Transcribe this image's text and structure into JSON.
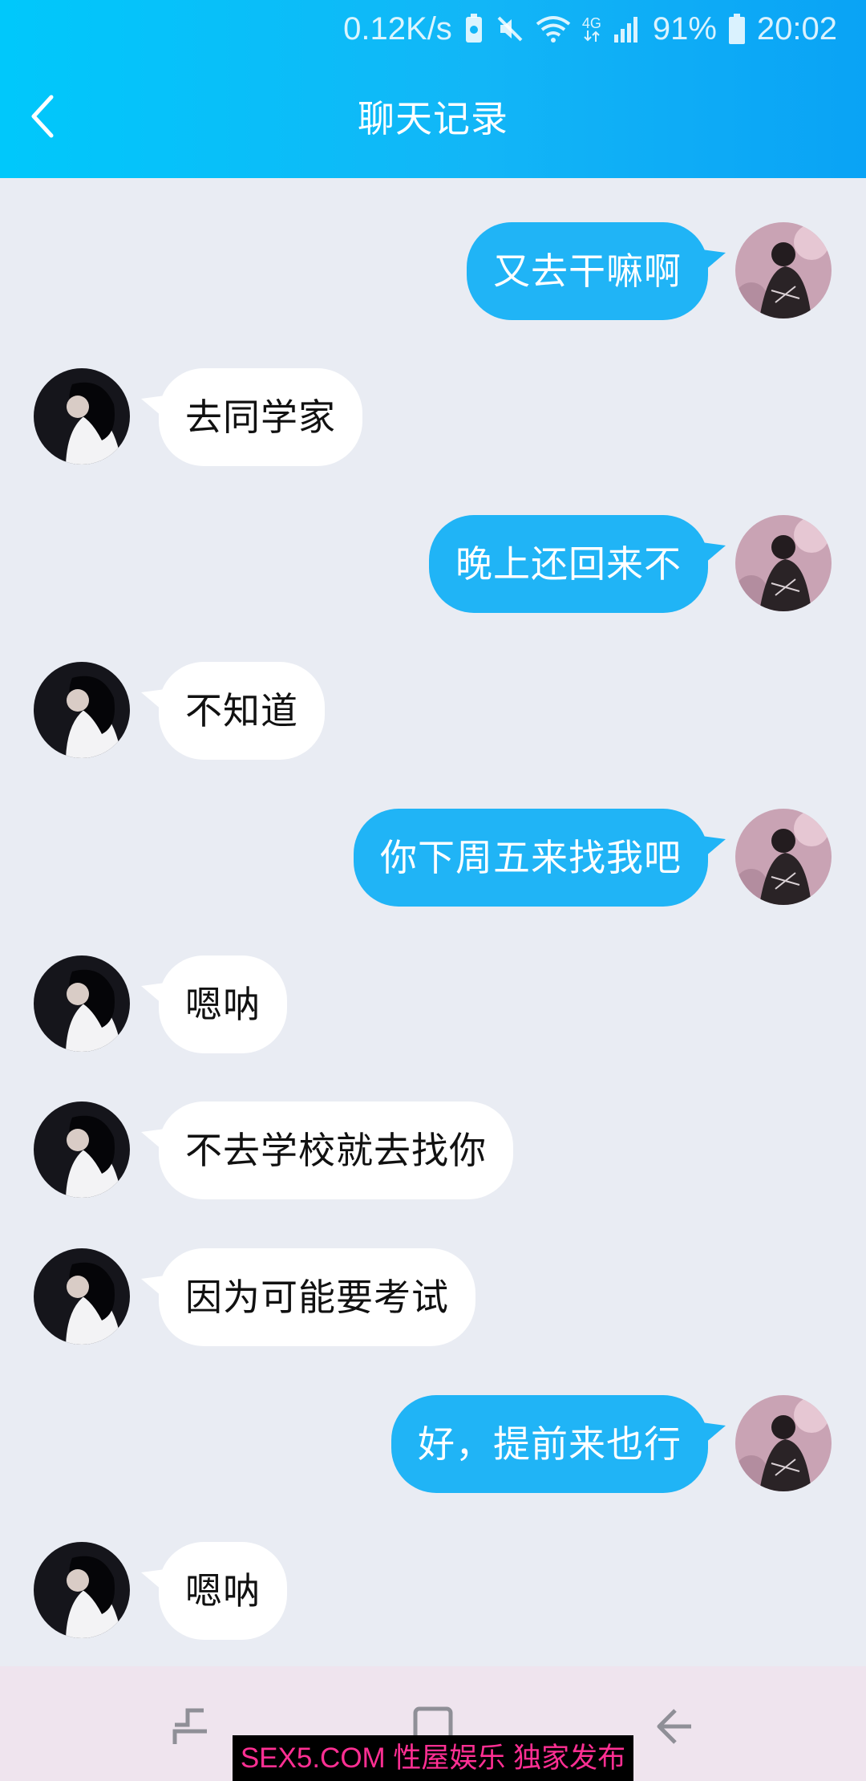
{
  "status_bar": {
    "speed": "0.12K/s",
    "network_type": "4G",
    "battery": "91%",
    "time": "20:02"
  },
  "header": {
    "title": "聊天记录",
    "back_icon": "chevron-left-icon"
  },
  "colors": {
    "header_gradient_start": "#00c8fb",
    "header_gradient_end": "#0aa3f5",
    "sent_bubble": "#20b4f6",
    "received_bubble": "#ffffff",
    "background": "#e9ecf3",
    "navbar": "#efe4ee",
    "watermark_text": "#ff2f93"
  },
  "messages": [
    {
      "side": "right",
      "text": "又去干嘛啊"
    },
    {
      "side": "left",
      "text": "去同学家"
    },
    {
      "side": "right",
      "text": "晚上还回来不"
    },
    {
      "side": "left",
      "text": "不知道"
    },
    {
      "side": "right",
      "text": "你下周五来找我吧"
    },
    {
      "side": "left",
      "text": "嗯呐"
    },
    {
      "side": "left",
      "text": "不去学校就去找你"
    },
    {
      "side": "left",
      "text": "因为可能要考试"
    },
    {
      "side": "right",
      "text": "好，提前来也行"
    },
    {
      "side": "left",
      "text": "嗯呐"
    }
  ],
  "navbar": {
    "recent_icon": "recent-apps-icon",
    "home_icon": "home-icon",
    "back_icon": "back-arrow-icon"
  },
  "watermark": {
    "text": "SEX5.COM 性屋娱乐 独家发布"
  }
}
